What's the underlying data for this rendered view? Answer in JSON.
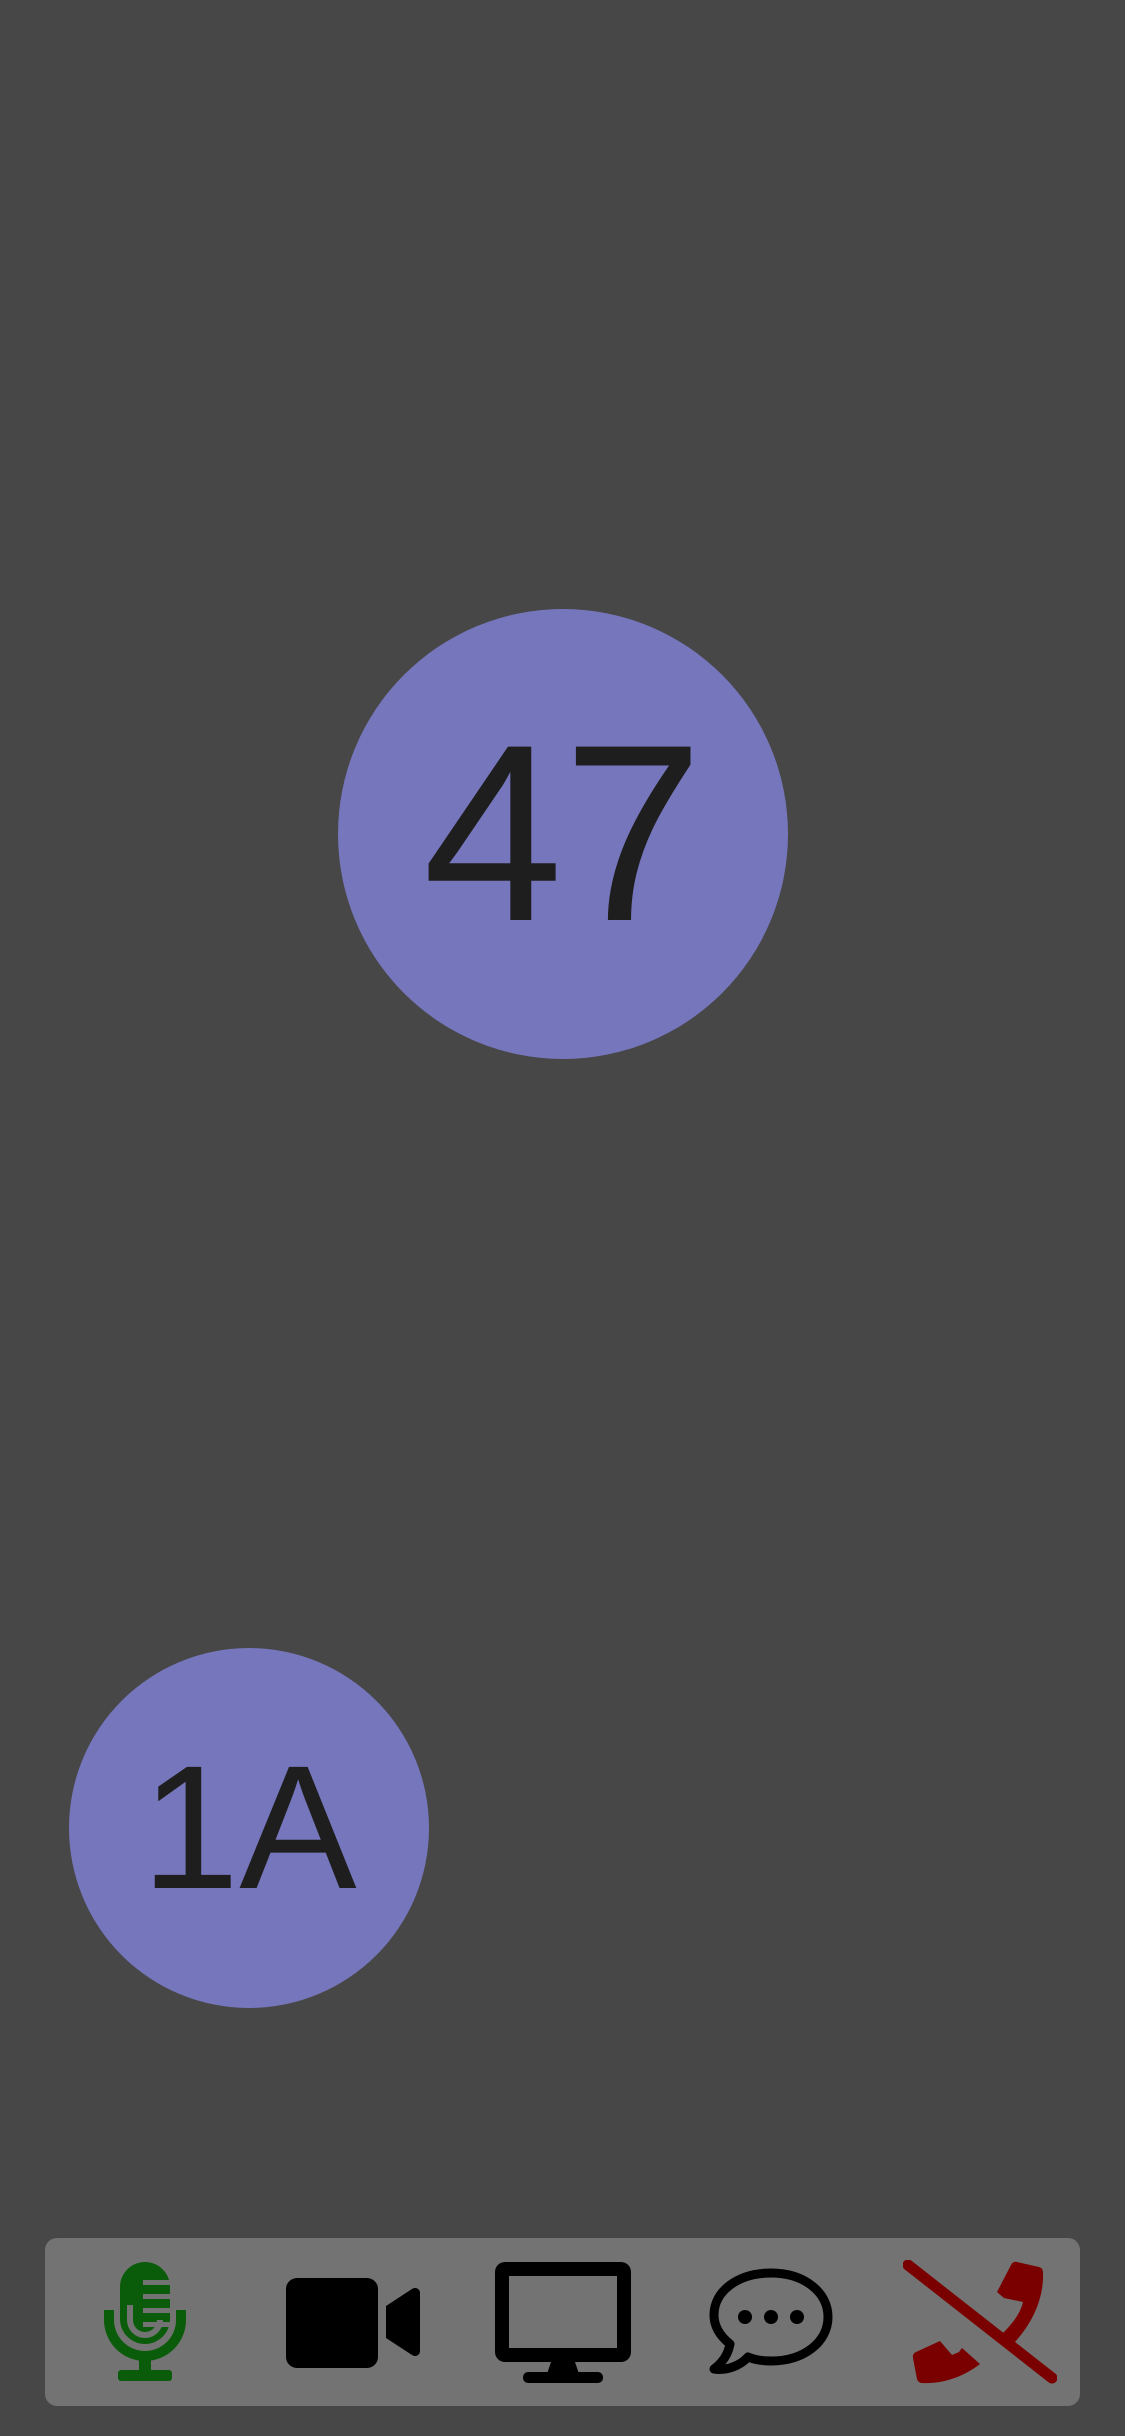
{
  "participants": {
    "main": {
      "label": "47"
    },
    "self": {
      "label": "1A"
    }
  },
  "controls": [
    {
      "name": "microphone",
      "icon": "microphone-icon",
      "state": "on",
      "color": "#0a5c0a"
    },
    {
      "name": "camera",
      "icon": "video-camera-icon",
      "color": "#000000"
    },
    {
      "name": "screen-share",
      "icon": "monitor-icon",
      "color": "#000000"
    },
    {
      "name": "chat",
      "icon": "chat-bubble-icon",
      "color": "#000000"
    },
    {
      "name": "hang-up",
      "icon": "phone-slash-icon",
      "color": "#7a0000"
    }
  ],
  "colors": {
    "background": "#474747",
    "avatar": "#7676bd",
    "avatar_text": "#1e1e1e",
    "control_bar": "#737373"
  }
}
